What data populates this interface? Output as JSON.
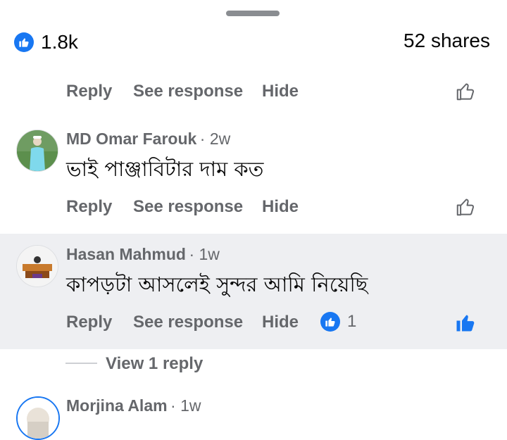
{
  "header": {
    "like_count": "1.8k",
    "shares": "52 shares"
  },
  "actions": {
    "reply": "Reply",
    "see_response": "See response",
    "hide": "Hide"
  },
  "comments": [
    {
      "name": "MD Omar Farouk",
      "time": "· 2w",
      "text": "ভাই পাঞ্জাবিটার দাম কত"
    },
    {
      "name": "Hasan Mahmud",
      "time": "· 1w",
      "text": "কাপড়টা আসলেই সুন্দর আমি নিয়েছি",
      "reaction_count": "1"
    },
    {
      "name": "Morjina Alam",
      "time": "· 1w"
    }
  ],
  "view_replies": "View 1 reply",
  "colors": {
    "accent": "#1877f2",
    "muted_text": "#65676b",
    "highlight_bg": "#eeeff2"
  }
}
